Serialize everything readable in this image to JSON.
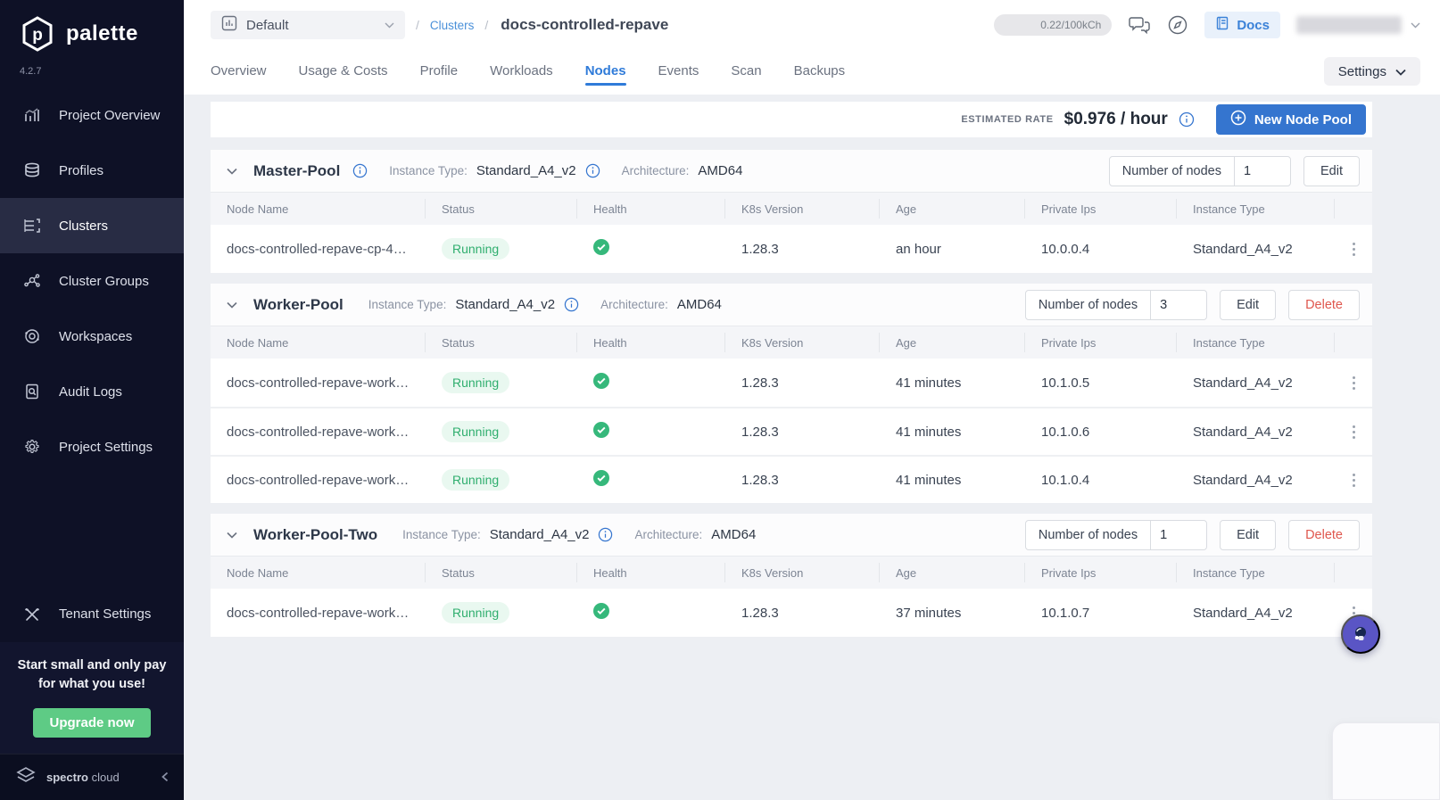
{
  "brand": {
    "name": "palette",
    "version": "4.2.7"
  },
  "sidebar": {
    "items": [
      {
        "label": "Project Overview"
      },
      {
        "label": "Profiles"
      },
      {
        "label": "Clusters"
      },
      {
        "label": "Cluster Groups"
      },
      {
        "label": "Workspaces"
      },
      {
        "label": "Audit Logs"
      },
      {
        "label": "Project Settings"
      },
      {
        "label": "Tenant Settings"
      }
    ],
    "active_item": "Clusters",
    "upsell": {
      "message": "Start small and only pay for what you use!",
      "cta": "Upgrade now"
    },
    "footer": {
      "brand_bold": "spectro",
      "brand_light": "cloud"
    }
  },
  "topbar": {
    "project_selector": {
      "value": "Default"
    },
    "breadcrumb": {
      "separator": "/",
      "root": "Clusters",
      "current": "docs-controlled-repave"
    },
    "usage_pill": "0.22/100kCh",
    "docs_button": "Docs"
  },
  "tabs": {
    "items": [
      "Overview",
      "Usage & Costs",
      "Profile",
      "Workloads",
      "Nodes",
      "Events",
      "Scan",
      "Backups"
    ],
    "active": "Nodes"
  },
  "settings_button": "Settings",
  "rate_bar": {
    "label": "ESTIMATED RATE",
    "value": "$0.976 / hour",
    "new_node_pool": "New Node Pool"
  },
  "labels": {
    "instance_type": "Instance Type:",
    "architecture": "Architecture:",
    "number_of_nodes": "Number of nodes",
    "edit": "Edit",
    "delete": "Delete"
  },
  "table_columns": [
    "Node Name",
    "Status",
    "Health",
    "K8s Version",
    "Age",
    "Private Ips",
    "Instance Type"
  ],
  "pools": [
    {
      "name": "Master-Pool",
      "instance_type": "Standard_A4_v2",
      "architecture": "AMD64",
      "number_of_nodes": "1",
      "rows": [
        {
          "name": "docs-controlled-repave-cp-4…",
          "status": "Running",
          "k8s_version": "1.28.3",
          "age": "an hour",
          "private_ip": "10.0.0.4",
          "instance_type": "Standard_A4_v2"
        }
      ]
    },
    {
      "name": "Worker-Pool",
      "instance_type": "Standard_A4_v2",
      "architecture": "AMD64",
      "number_of_nodes": "3",
      "rows": [
        {
          "name": "docs-controlled-repave-work…",
          "status": "Running",
          "k8s_version": "1.28.3",
          "age": "41 minutes",
          "private_ip": "10.1.0.5",
          "instance_type": "Standard_A4_v2"
        },
        {
          "name": "docs-controlled-repave-work…",
          "status": "Running",
          "k8s_version": "1.28.3",
          "age": "41 minutes",
          "private_ip": "10.1.0.6",
          "instance_type": "Standard_A4_v2"
        },
        {
          "name": "docs-controlled-repave-work…",
          "status": "Running",
          "k8s_version": "1.28.3",
          "age": "41 minutes",
          "private_ip": "10.1.0.4",
          "instance_type": "Standard_A4_v2"
        }
      ]
    },
    {
      "name": "Worker-Pool-Two",
      "instance_type": "Standard_A4_v2",
      "architecture": "AMD64",
      "number_of_nodes": "1",
      "rows": [
        {
          "name": "docs-controlled-repave-work…",
          "status": "Running",
          "k8s_version": "1.28.3",
          "age": "37 minutes",
          "private_ip": "10.1.0.7",
          "instance_type": "Standard_A4_v2"
        }
      ]
    }
  ],
  "colors": {
    "sidebar_bg": "#0e1126",
    "accent_blue": "#3575cf",
    "active_tab_blue": "#2f7bd9",
    "running_green": "#2fae6e",
    "health_green": "#36b87b",
    "delete_red": "#df574e",
    "upgrade_green": "#5ecb85",
    "fab_purple": "#5a55c5"
  }
}
